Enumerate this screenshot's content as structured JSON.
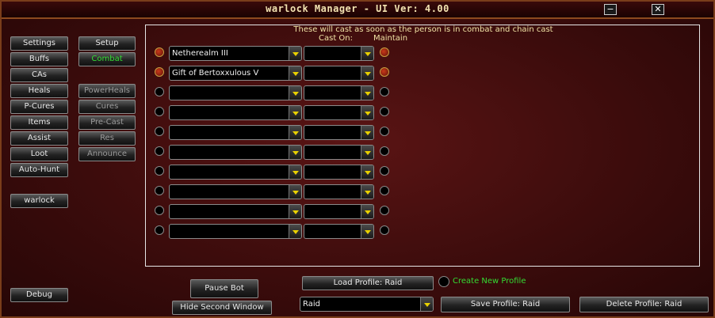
{
  "title": "warlock Manager   - UI Ver: 4.00",
  "window_controls": {
    "minimize": "−",
    "close": "✕"
  },
  "nav_left": [
    "Settings",
    "Buffs",
    "CAs",
    "Heals",
    "P-Cures",
    "Items",
    "Assist",
    "Loot",
    "Auto-Hunt"
  ],
  "nav_right": [
    "Setup",
    "Combat",
    "PowerHeals",
    "Cures",
    "Pre-Cast",
    "Res",
    "Announce"
  ],
  "active_tab": "Combat",
  "profile_name": "warlock",
  "debug_label": "Debug",
  "panel": {
    "heading": "These will cast as soon as the person is in combat and chain cast",
    "cast_on_header": "Cast On:",
    "maintain_header": "Maintain"
  },
  "spell_rows": [
    {
      "spell": "Netherealm III",
      "cast_on": "",
      "enabled": true,
      "maintain": true
    },
    {
      "spell": "Gift of Bertoxxulous V",
      "cast_on": "",
      "enabled": true,
      "maintain": true
    },
    {
      "spell": "",
      "cast_on": "",
      "enabled": false,
      "maintain": false
    },
    {
      "spell": "",
      "cast_on": "",
      "enabled": false,
      "maintain": false
    },
    {
      "spell": "",
      "cast_on": "",
      "enabled": false,
      "maintain": false
    },
    {
      "spell": "",
      "cast_on": "",
      "enabled": false,
      "maintain": false
    },
    {
      "spell": "",
      "cast_on": "",
      "enabled": false,
      "maintain": false
    },
    {
      "spell": "",
      "cast_on": "",
      "enabled": false,
      "maintain": false
    },
    {
      "spell": "",
      "cast_on": "",
      "enabled": false,
      "maintain": false
    },
    {
      "spell": "",
      "cast_on": "",
      "enabled": false,
      "maintain": false
    }
  ],
  "bottom": {
    "pause_bot": "Pause Bot",
    "hide_second_window": "Hide Second Window",
    "load_profile": "Load Profile: Raid",
    "create_new_profile": "Create New Profile",
    "profile_select": "Raid",
    "save_profile": "Save Profile: Raid",
    "delete_profile": "Delete Profile: Raid"
  },
  "colors": {
    "active_tab": "#33dd33",
    "heading": "#f0e2a4",
    "create_profile": "#33dd33"
  }
}
